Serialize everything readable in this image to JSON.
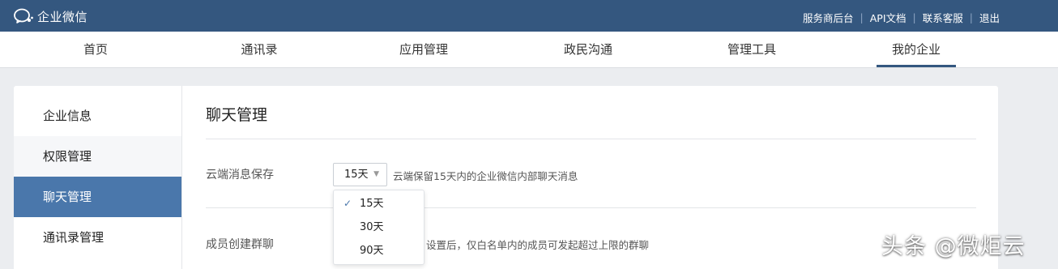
{
  "header": {
    "logo_text": "企业微信",
    "links": [
      "服务商后台",
      "API文档",
      "联系客服",
      "退出"
    ]
  },
  "nav": {
    "tabs": [
      "首页",
      "通讯录",
      "应用管理",
      "政民沟通",
      "管理工具",
      "我的企业"
    ],
    "active": "我的企业"
  },
  "sidebar": {
    "items": [
      "企业信息",
      "权限管理",
      "聊天管理",
      "通讯录管理"
    ],
    "active": "聊天管理"
  },
  "main": {
    "title": "聊天管理",
    "cloud_storage": {
      "label": "云端消息保存",
      "selected": "15天",
      "description": "云端保留15天内的企业微信内部聊天消息"
    },
    "dropdown_options": [
      "15天",
      "30天",
      "90天"
    ],
    "member_group": {
      "label": "成员创建群聊",
      "description": "设置后，仅白名单内的成员可发起超过上限的群聊"
    }
  },
  "watermark": "头条 @微炬云",
  "colors": {
    "header_bg": "#34577f",
    "active_sidebar": "#4a77ab",
    "page_bg": "#ebedf0"
  }
}
